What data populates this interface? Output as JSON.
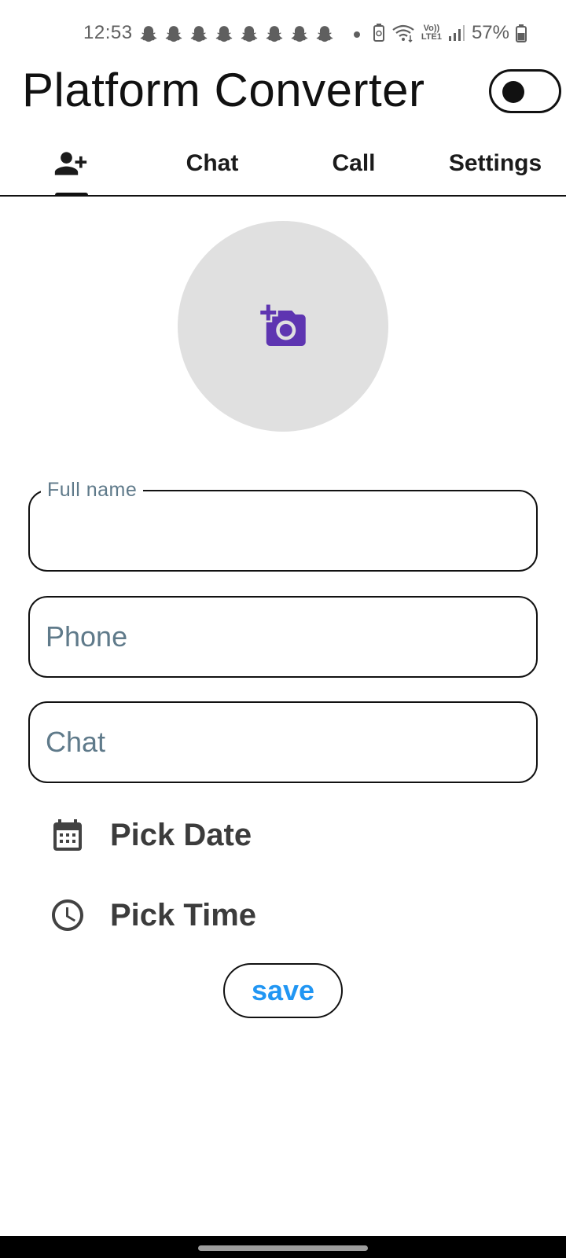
{
  "status_bar": {
    "time": "12:53",
    "notification_icons": [
      "snapchat-icon",
      "snapchat-icon",
      "snapchat-icon",
      "snapchat-icon",
      "snapchat-icon",
      "snapchat-icon",
      "snapchat-icon",
      "snapchat-icon"
    ],
    "network_label_top": "Vo))",
    "network_label_bottom": "LTE1",
    "battery": "57%"
  },
  "app": {
    "title": "Platform Converter",
    "theme_toggle_on": false
  },
  "tabs": [
    {
      "icon": "person-add-icon",
      "label": "",
      "selected": true
    },
    {
      "label": "Chat",
      "selected": false
    },
    {
      "label": "Call",
      "selected": false
    },
    {
      "label": "Settings",
      "selected": false
    }
  ],
  "form": {
    "avatar_icon": "add-a-photo-icon",
    "full_name": {
      "label": "Full name",
      "value": ""
    },
    "phone": {
      "placeholder": "Phone",
      "value": ""
    },
    "chat": {
      "placeholder": "Chat",
      "value": ""
    },
    "pick_date": {
      "icon": "calendar-icon",
      "label": "Pick Date"
    },
    "pick_time": {
      "icon": "clock-icon",
      "label": "Pick Time"
    },
    "save_label": "save"
  },
  "colors": {
    "accent_blue": "#2196f3",
    "camera_icon": "#5e35b1",
    "avatar_bg": "#e0e0e0",
    "hint_text": "#5f7a8a"
  }
}
